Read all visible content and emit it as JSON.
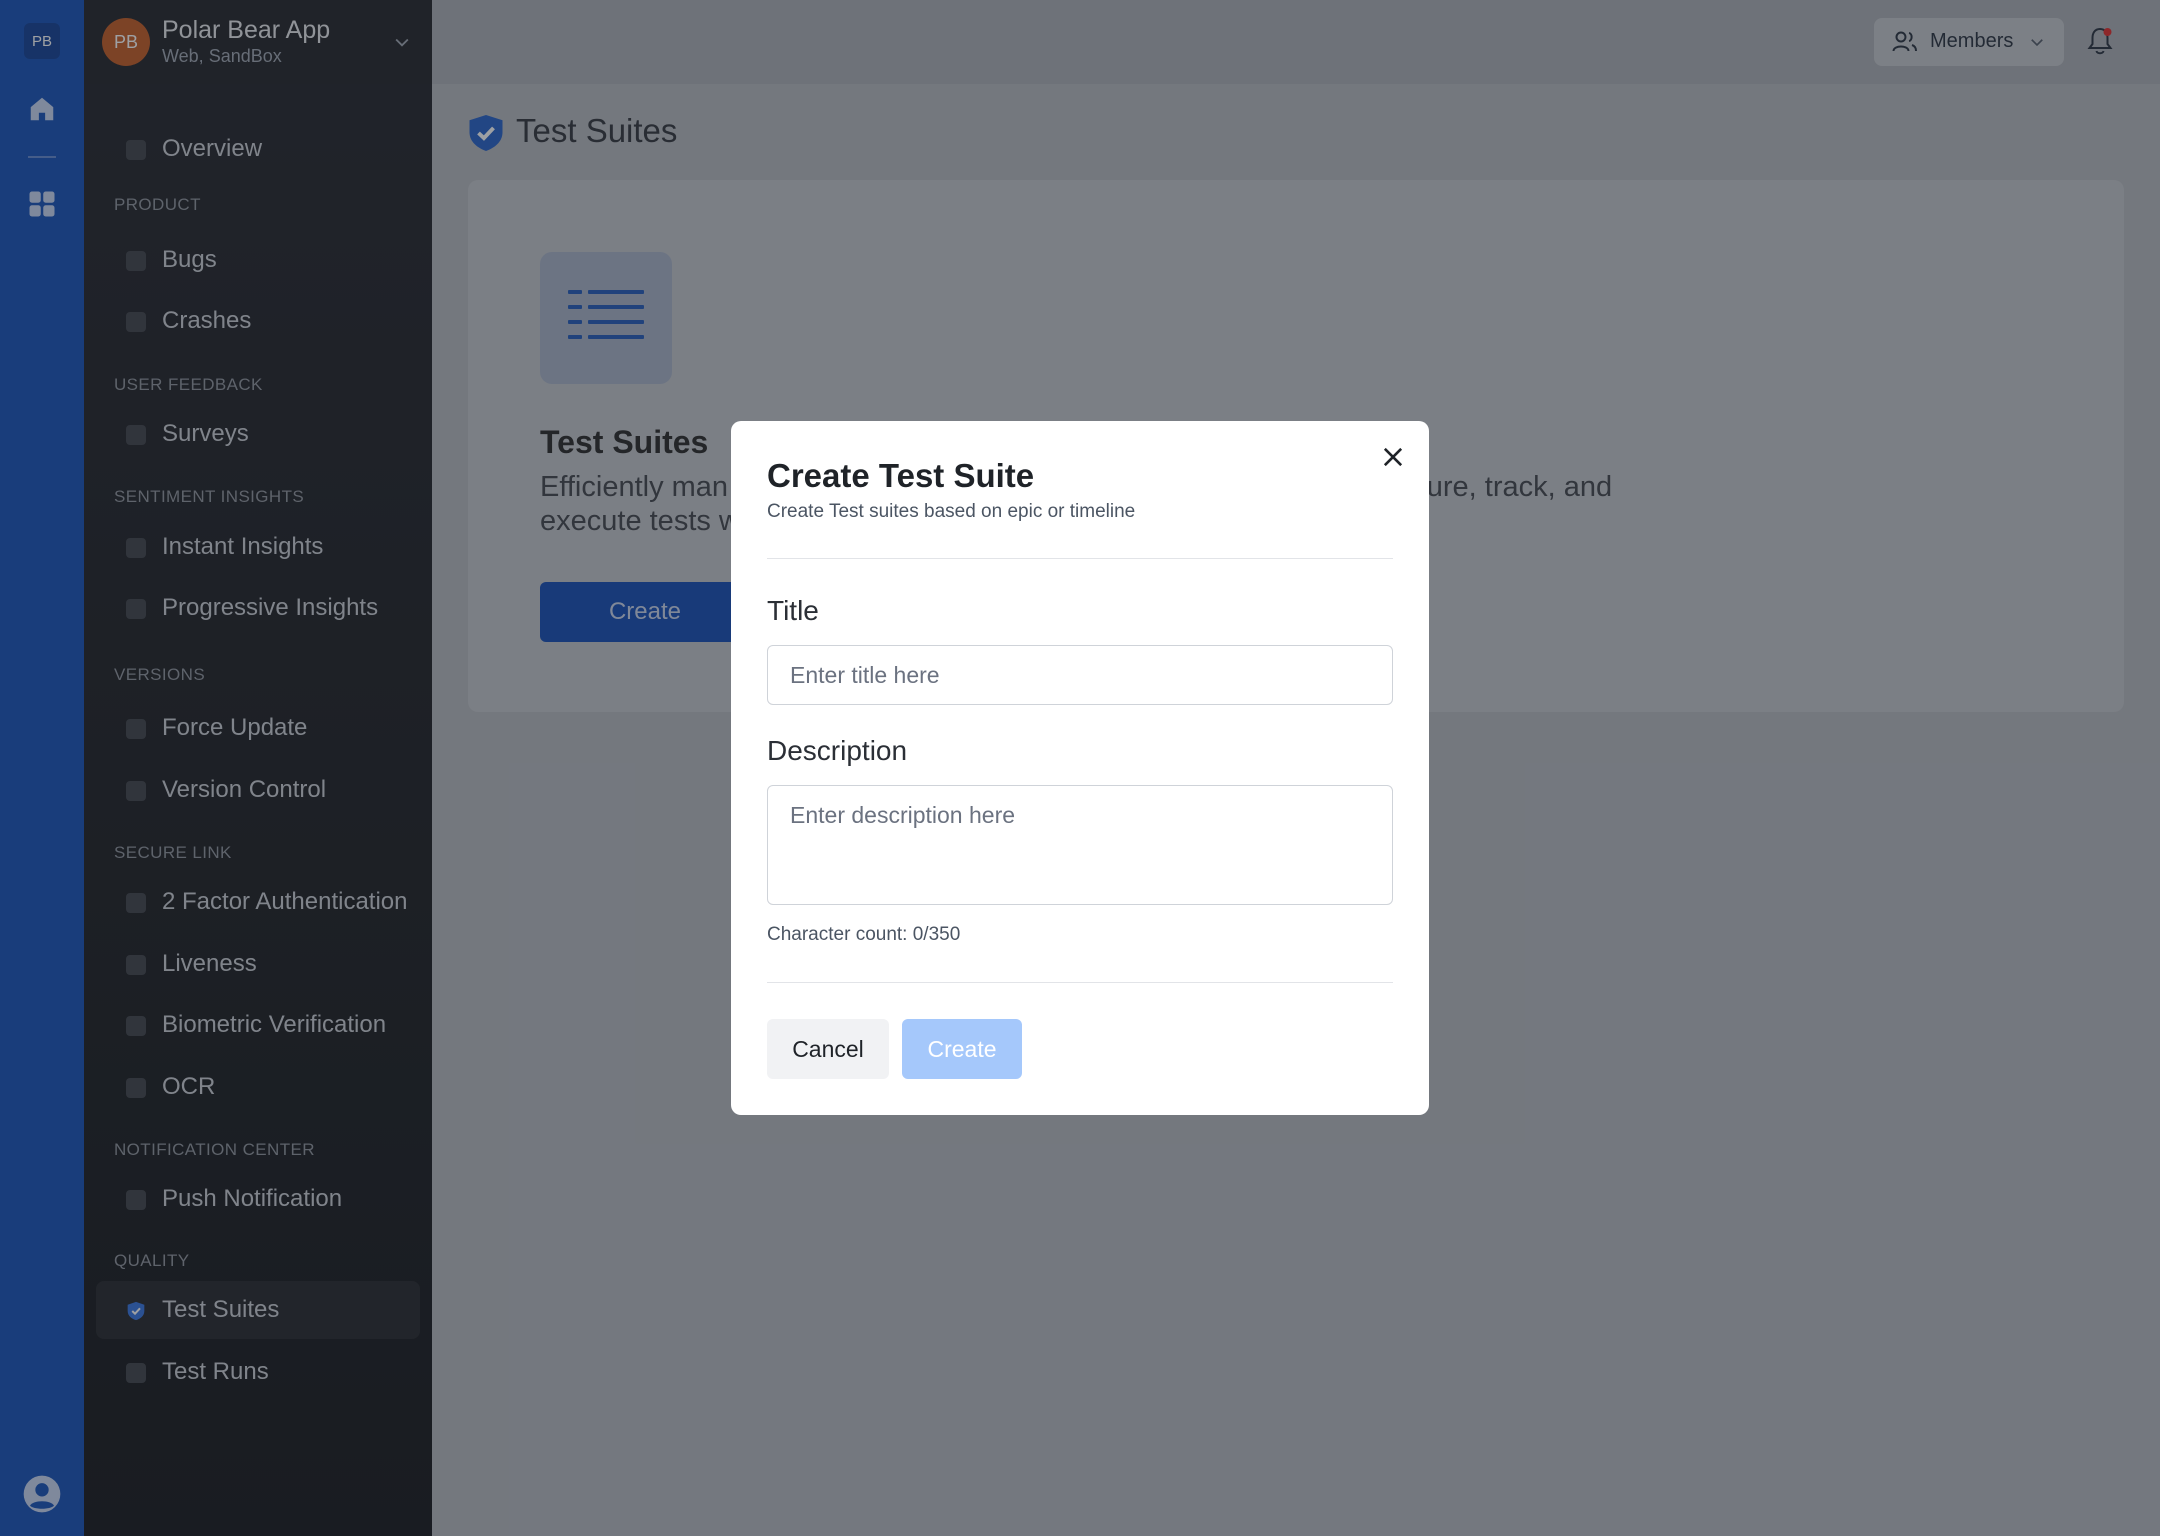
{
  "rail": {
    "workspace_badge": "PB"
  },
  "sidebar": {
    "avatar_initials": "PB",
    "app_name": "Polar Bear App",
    "app_env": "Web, SandBox",
    "overview": "Overview",
    "sections": {
      "product": "PRODUCT",
      "user_feedback": "USER FEEDBACK",
      "sentiment": "SENTIMENT INSIGHTS",
      "versions": "VERSIONS",
      "secure_link": "SECURE LINK",
      "notification": "NOTIFICATION CENTER",
      "quality": "QUALITY"
    },
    "items": {
      "bugs": "Bugs",
      "crashes": "Crashes",
      "surveys": "Surveys",
      "instant_insights": "Instant Insights",
      "progressive_insights": "Progressive Insights",
      "force_update": "Force Update",
      "version_control": "Version Control",
      "two_factor": "2 Factor Authentication",
      "liveness": "Liveness",
      "biometric": "Biometric Verification",
      "ocr": "OCR",
      "push": "Push Notification",
      "test_suites": "Test Suites",
      "test_runs": "Test Runs"
    }
  },
  "topbar": {
    "members_label": "Members"
  },
  "main": {
    "page_title": "Test Suites",
    "card_title": "Test Suites",
    "card_desc_left": "Efficiently man",
    "card_desc_left2": "execute tests w",
    "card_desc_right": "ucture, track, and",
    "card_button": "Create"
  },
  "modal": {
    "title": "Create Test Suite",
    "subtitle": "Create Test suites based on epic or timeline",
    "title_label": "Title",
    "title_placeholder": "Enter title here",
    "desc_label": "Description",
    "desc_placeholder": "Enter description here",
    "char_count": "Character count: 0/350",
    "cancel_label": "Cancel",
    "create_label": "Create"
  },
  "colors": {
    "rail": "#0e4bb6",
    "accent": "#0b46b2",
    "create_disabled": "#a5c8fb",
    "notification_dot": "#e02424"
  }
}
